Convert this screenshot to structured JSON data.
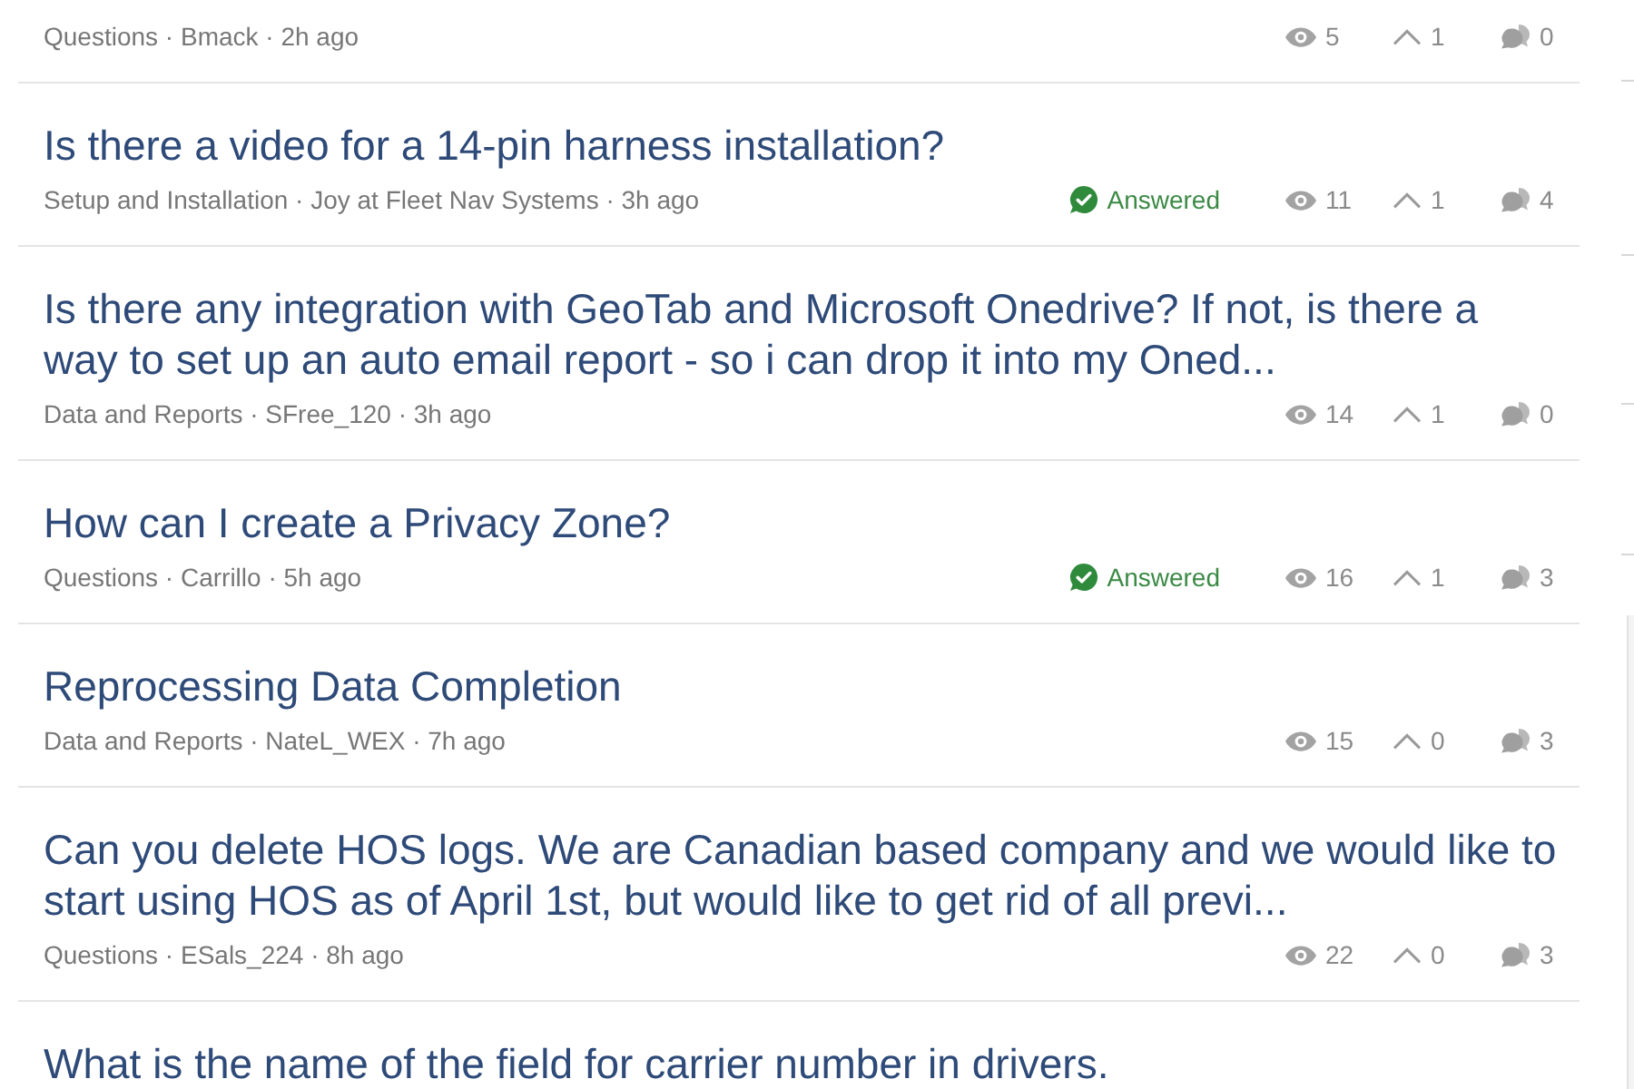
{
  "topics": [
    {
      "meta": "Questions · Bmack · 2h ago",
      "answered": false,
      "views": "5",
      "votes": "1",
      "replies": "0"
    },
    {
      "title": "Is there a video for a 14-pin harness installation?",
      "meta": "Setup and Installation · Joy at Fleet Nav Systems · 3h ago",
      "answered": true,
      "answered_label": "Answered",
      "views": "11",
      "votes": "1",
      "replies": "4"
    },
    {
      "title": "Is there any integration with GeoTab and Microsoft Onedrive? If not, is there a way to set up an auto email report - so i can drop it into my Oned...",
      "meta": "Data and Reports · SFree_120 · 3h ago",
      "answered": false,
      "views": "14",
      "votes": "1",
      "replies": "0"
    },
    {
      "title": "How can I create a Privacy Zone?",
      "meta": "Questions · Carrillo · 5h ago",
      "answered": true,
      "answered_label": "Answered",
      "views": "16",
      "votes": "1",
      "replies": "3"
    },
    {
      "title": "Reprocessing Data Completion",
      "meta": "Data and Reports · NateL_WEX · 7h ago",
      "answered": false,
      "views": "15",
      "votes": "0",
      "replies": "3"
    },
    {
      "title": "Can you delete HOS logs. We are Canadian based company and we would like to start using HOS as of April 1st, but would like to get rid of all previ...",
      "meta": "Questions · ESals_224 · 8h ago",
      "answered": false,
      "views": "22",
      "votes": "0",
      "replies": "3"
    },
    {
      "title": "What is the name of the field for carrier number in drivers."
    }
  ]
}
